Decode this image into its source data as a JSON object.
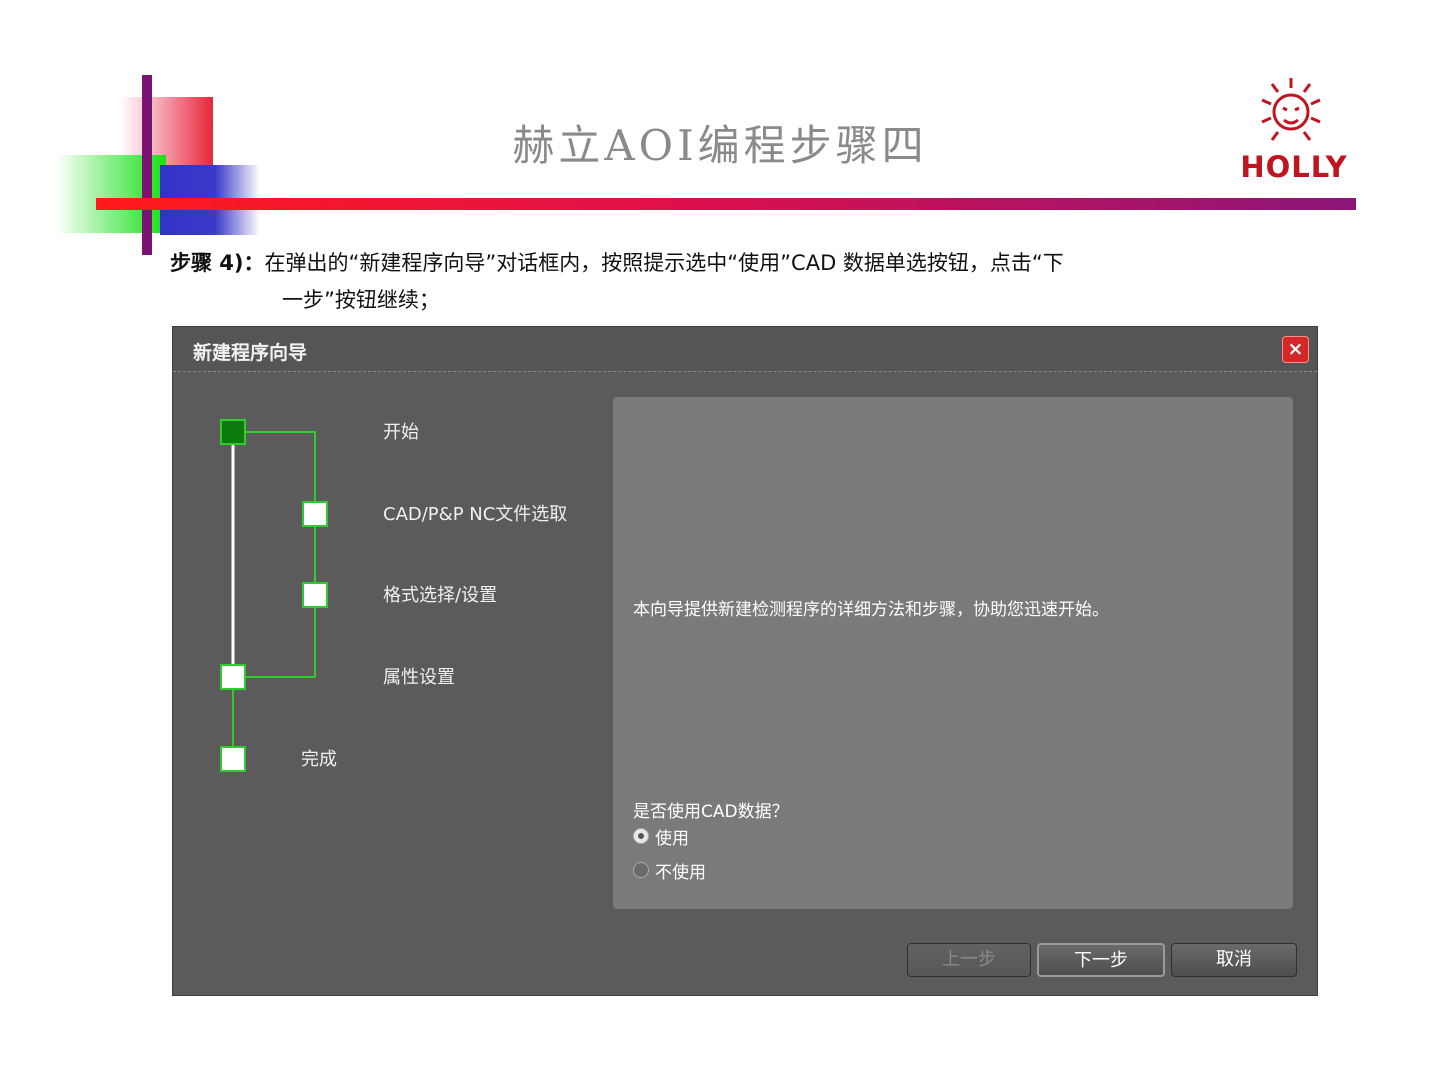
{
  "slide": {
    "title": "赫立AOI编程步骤四",
    "logo_text": "HOLLY",
    "step_label": "步骤 4)：",
    "step_text_line1": "在弹出的“新建程序向导”对话框内，按照提示选中“使用”CAD 数据单选按钮，点击“下",
    "step_text_line2": "一步”按钮继续；"
  },
  "dialog": {
    "title": "新建程序向导",
    "close_label": "×",
    "steps": [
      {
        "label": "开始",
        "state": "active"
      },
      {
        "label": "CAD/P&P NC文件选取",
        "state": "optional"
      },
      {
        "label": "格式选择/设置",
        "state": "optional"
      },
      {
        "label": "属性设置",
        "state": "pending"
      },
      {
        "label": "完成",
        "state": "pending"
      }
    ],
    "info_text": "本向导提供新建检测程序的详细方法和步骤，协助您迅速开始。",
    "question": "是否使用CAD数据？",
    "options": [
      {
        "label": "使用",
        "selected": true
      },
      {
        "label": "不使用",
        "selected": false
      }
    ],
    "buttons": {
      "prev": "上一步",
      "next": "下一步",
      "cancel": "取消"
    }
  },
  "colors": {
    "accent_red": "#c0141e",
    "step_line_green": "#2fcc2f",
    "active_step": "#0a7a0a"
  }
}
